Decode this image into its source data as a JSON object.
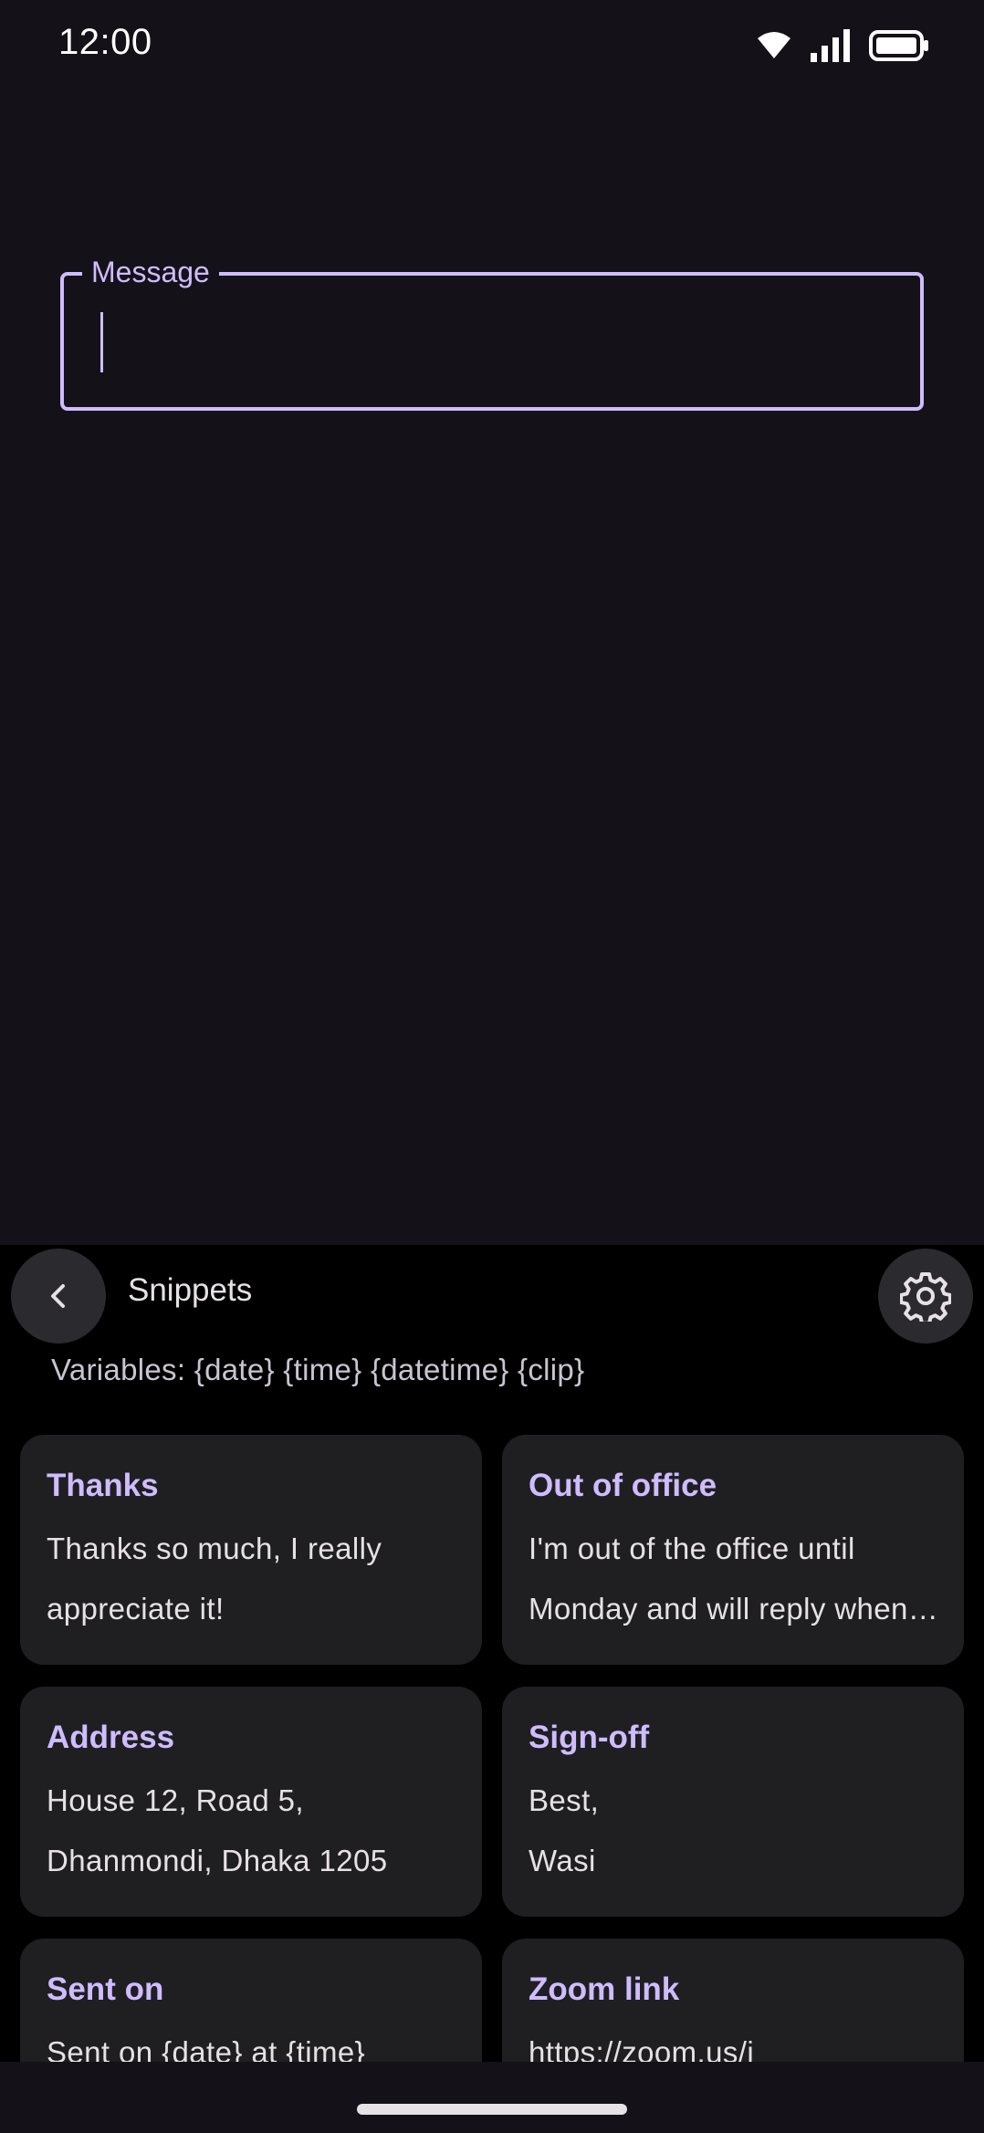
{
  "status_bar": {
    "time": "12:00",
    "icons": [
      "wifi-icon",
      "cellular-signal-icon",
      "battery-icon"
    ]
  },
  "message_field": {
    "label": "Message",
    "value": ""
  },
  "snippets": {
    "title": "Snippets",
    "back_icon": "chevron-left-icon",
    "settings_icon": "gear-icon",
    "variables": "Variables: {date} {time} {datetime} {clip}",
    "items": [
      {
        "title": "Thanks",
        "body": "Thanks so much, I really appreciate it!"
      },
      {
        "title": "Out of office",
        "body": "I'm out of the office until Monday and will reply when I'm back."
      },
      {
        "title": "Address",
        "lines": [
          "House 12, Road 5,",
          "Dhanmondi, Dhaka 1205"
        ]
      },
      {
        "title": "Sign-off",
        "lines": [
          "Best,",
          "Wasi"
        ]
      },
      {
        "title": "Sent on",
        "body": "Sent on {date} at {time}"
      },
      {
        "title": "Zoom link",
        "body": "https://zoom.us/j"
      }
    ]
  },
  "colors": {
    "background": "#141218",
    "accent": "#cfbcff",
    "panel": "#000000",
    "card": "#1f1f22"
  }
}
